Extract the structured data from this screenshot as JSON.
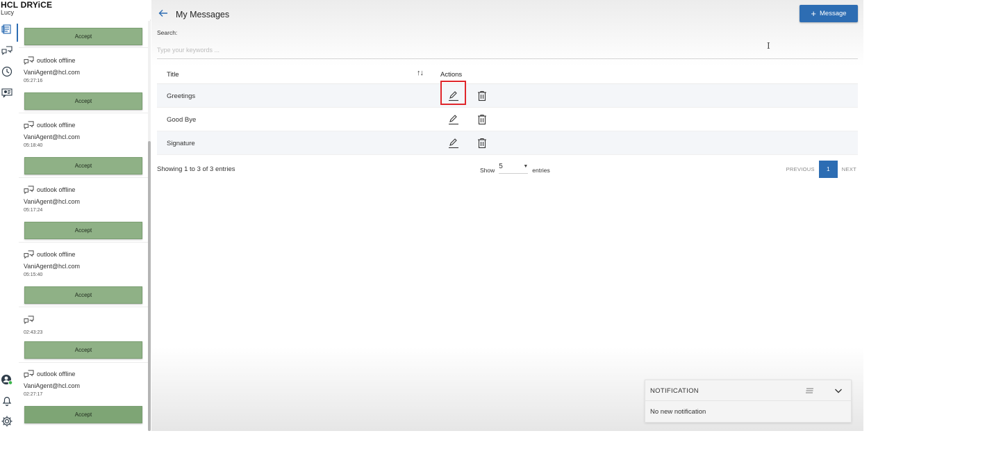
{
  "brand": {
    "logo": "HCL DRYiCE",
    "user": "Lucy"
  },
  "rail": {
    "items": [
      {
        "icon": "messages-icon",
        "active": true
      },
      {
        "icon": "chat-icon",
        "active": false
      },
      {
        "icon": "history-clock-icon",
        "active": false
      },
      {
        "icon": "video-chat-icon",
        "active": false
      }
    ],
    "bottom": [
      {
        "icon": "agent-status-avatar-icon"
      },
      {
        "icon": "bell-icon"
      },
      {
        "icon": "gear-icon"
      }
    ]
  },
  "chats": {
    "accept_label": "Accept",
    "items": [
      {
        "title": "",
        "email": "",
        "time": ""
      },
      {
        "title": "outlook offline",
        "email": "VaniAgent@hcl.com",
        "time": "05:27:16"
      },
      {
        "title": "outlook offline",
        "email": "VaniAgent@hcl.com",
        "time": "05:18:40"
      },
      {
        "title": "outlook offline",
        "email": "VaniAgent@hcl.com",
        "time": "05:17:24"
      },
      {
        "title": "outlook offline",
        "email": "VaniAgent@hcl.com",
        "time": "05:15:40"
      },
      {
        "title": "",
        "email": "",
        "time": "02:43:23"
      },
      {
        "title": "outlook offline",
        "email": "VaniAgent@hcl.com",
        "time": "02:27:17"
      }
    ]
  },
  "header": {
    "title": "My Messages",
    "new_button": "Message"
  },
  "search": {
    "label": "Search:",
    "placeholder": "Type your keywords ...",
    "value": ""
  },
  "table": {
    "columns": {
      "title": "Title",
      "actions": "Actions"
    },
    "rows": [
      {
        "title": "Greetings"
      },
      {
        "title": "Good Bye"
      },
      {
        "title": "Signature"
      }
    ]
  },
  "pagination": {
    "entries_info": "Showing 1 to 3 of 3 entries",
    "show_label": "Show",
    "page_size": "5",
    "entries_label": "entries",
    "previous": "PREVIOUS",
    "current_page": "1",
    "next": "NEXT"
  },
  "notification": {
    "title": "NOTIFICATION",
    "body": "No new notification"
  },
  "colors": {
    "primary": "#2d6db3",
    "accept": "#8fb186",
    "highlight": "#e0262b"
  }
}
